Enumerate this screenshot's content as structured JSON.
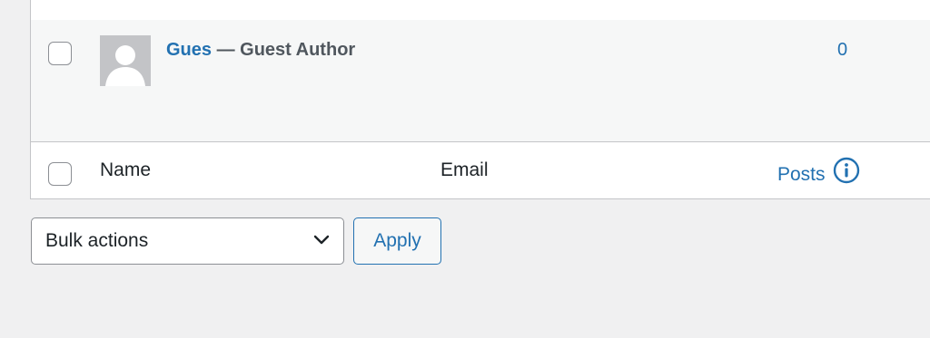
{
  "users_table": {
    "rows": [
      {
        "username": "Gues",
        "separator": " — ",
        "display_name": "Guest Author",
        "posts": "0",
        "avatar_icon": "default-avatar-icon"
      }
    ],
    "footer_columns": {
      "name": "Name",
      "email": "Email",
      "posts": "Posts",
      "posts_icon": "info-icon"
    }
  },
  "bulk_actions": {
    "selected": "Bulk actions",
    "dropdown_icon": "chevron-down-icon",
    "apply_label": "Apply"
  },
  "colors": {
    "link": "#2271b1",
    "border": "#c3c4c7",
    "page_bg": "#f0f0f1",
    "row_alt_bg": "#f6f7f7"
  }
}
